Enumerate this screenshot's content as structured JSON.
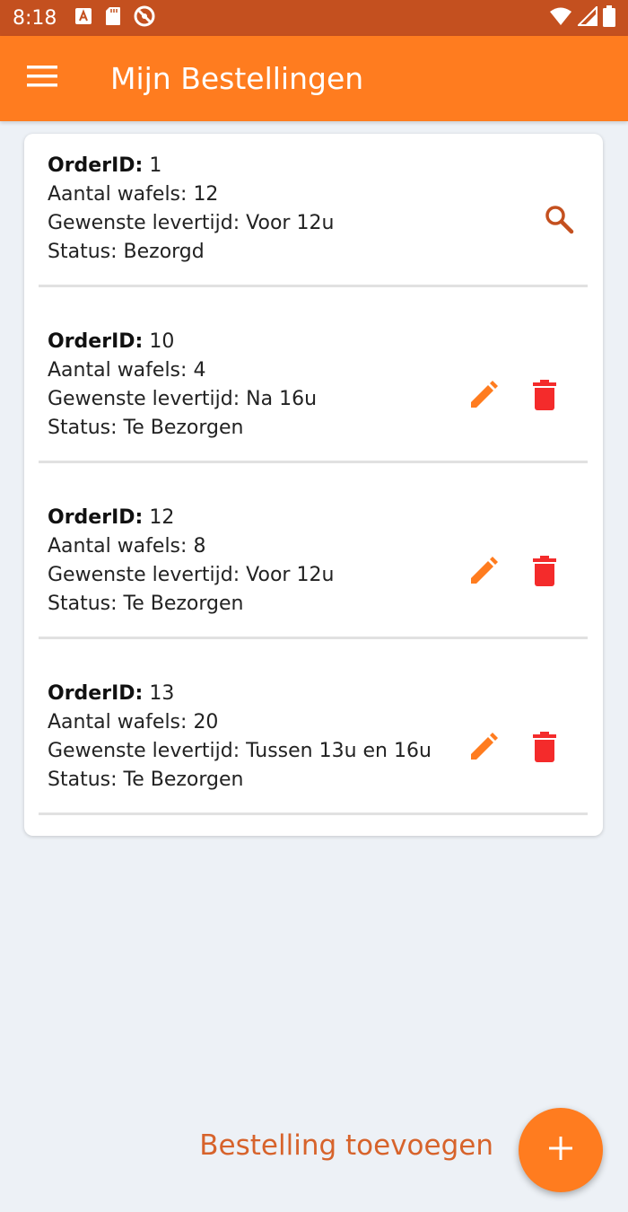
{
  "status_bar": {
    "time": "8:18",
    "left_icons": [
      "a-notification-icon",
      "sd-card-icon",
      "dnd-icon"
    ],
    "right_icons": [
      "wifi-icon",
      "signal-icon",
      "battery-icon"
    ]
  },
  "app_bar": {
    "title": "Mijn Bestellingen",
    "menu_icon": "menu-icon"
  },
  "labels": {
    "order_id": "OrderID:",
    "quantity": "Aantal wafels:",
    "delivery_time": "Gewenste levertijd:",
    "status": "Status:"
  },
  "orders": [
    {
      "order_id": "1",
      "quantity": "12",
      "delivery_time": "Voor 12u",
      "status": "Bezorgd",
      "actions": [
        "search-icon"
      ]
    },
    {
      "order_id": "10",
      "quantity": "4",
      "delivery_time": "Na 16u",
      "status": "Te Bezorgen",
      "actions": [
        "edit-icon",
        "delete-icon"
      ]
    },
    {
      "order_id": "12",
      "quantity": "8",
      "delivery_time": "Voor 12u",
      "status": "Te Bezorgen",
      "actions": [
        "edit-icon",
        "delete-icon"
      ]
    },
    {
      "order_id": "13",
      "quantity": "20",
      "delivery_time": "Tussen 13u en 16u",
      "status": "Te Bezorgen",
      "actions": [
        "edit-icon",
        "delete-icon"
      ]
    }
  ],
  "fab": {
    "label": "Bestelling toevoegen",
    "icon": "plus-icon"
  },
  "colors": {
    "status_bar": "#c4501f",
    "app_bar": "#ff7c1f",
    "accent": "#ff7c1f",
    "search_icon": "#c4501f",
    "delete_icon": "#f42b2b",
    "fab_label": "#d7632b",
    "background": "#edf1f6"
  }
}
